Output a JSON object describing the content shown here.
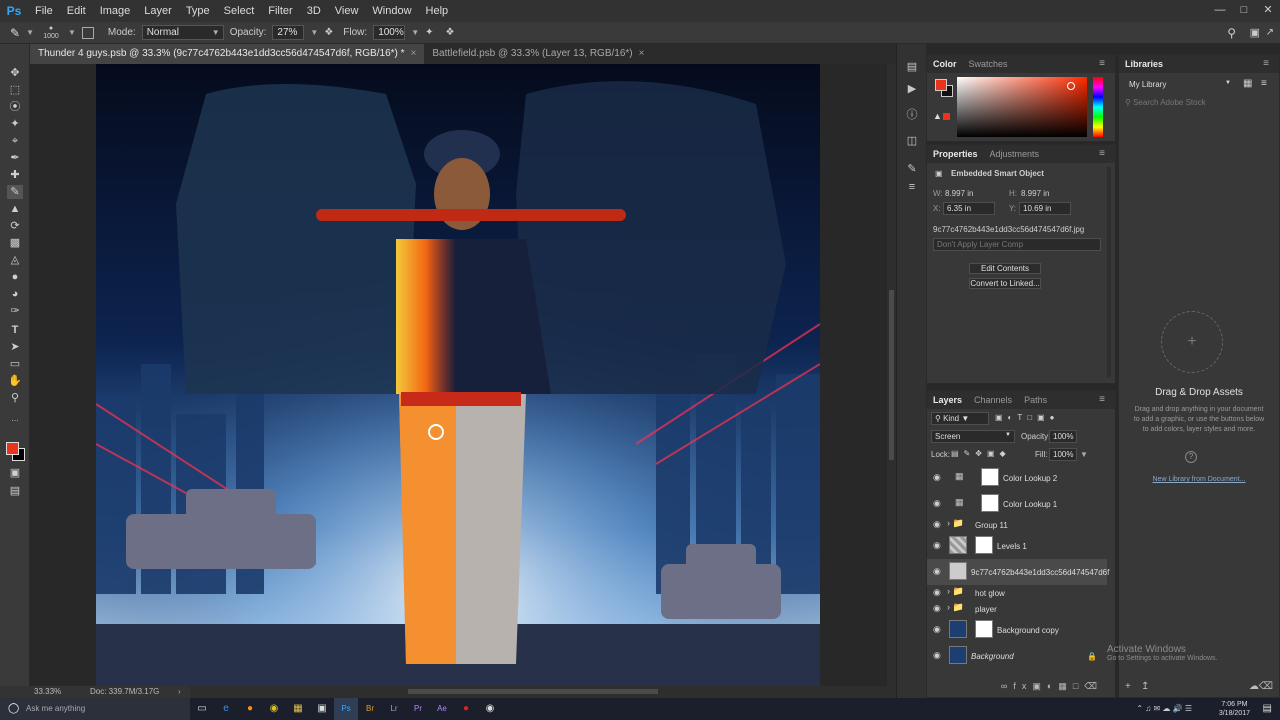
{
  "app": {
    "logo": "Ps"
  },
  "menu": [
    "File",
    "Edit",
    "Image",
    "Layer",
    "Type",
    "Select",
    "Filter",
    "3D",
    "View",
    "Window",
    "Help"
  ],
  "options": {
    "brush_size": "1000",
    "mode_label": "Mode:",
    "mode_value": "Normal",
    "opacity_label": "Opacity:",
    "opacity_value": "27%",
    "flow_label": "Flow:",
    "flow_value": "100%"
  },
  "tabs": [
    {
      "label": "Thunder 4 guys.psb @ 33.3% (9c77c4762b443e1dd3cc56d474547d6f, RGB/16*) *",
      "active": true
    },
    {
      "label": "Battlefield.psb @ 33.3% (Layer 13, RGB/16*)",
      "active": false
    }
  ],
  "status": {
    "zoom": "33.33%",
    "doc": "Doc: 339.7M/3.17G"
  },
  "color_panel": {
    "tabs": [
      "Color",
      "Swatches"
    ],
    "fg": "#e8341c",
    "bg": "#111111"
  },
  "properties": {
    "tabs": [
      "Properties",
      "Adjustments"
    ],
    "title": "Embedded Smart Object",
    "w_label": "W:",
    "w": "8.997 in",
    "h_label": "H:",
    "h": "8.997 in",
    "x_label": "X:",
    "x": "6.35 in",
    "y_label": "Y:",
    "y": "10.69 in",
    "filename": "9c77c4762b443e1dd3cc56d474547d6f.jpg",
    "layer_comp": "Don't Apply Layer Comp",
    "edit_btn": "Edit Contents",
    "convert_btn": "Convert to Linked..."
  },
  "layers_panel": {
    "tabs": [
      "Layers",
      "Channels",
      "Paths"
    ],
    "kind": "Kind",
    "blend": "Screen",
    "opacity_label": "Opacity:",
    "opacity": "100%",
    "lock_label": "Lock:",
    "fill_label": "Fill:",
    "fill": "100%",
    "layers": [
      {
        "name": "Color Lookup 2",
        "type": "adjustment"
      },
      {
        "name": "Color Lookup 1",
        "type": "adjustment"
      },
      {
        "name": "Group 11",
        "type": "group"
      },
      {
        "name": "Levels 1",
        "type": "levels"
      },
      {
        "name": "9c77c4762b443e1dd3cc56d474547d6f",
        "type": "smart",
        "selected": true
      },
      {
        "name": "hot glow",
        "type": "group"
      },
      {
        "name": "player",
        "type": "group"
      },
      {
        "name": "Background copy",
        "type": "image"
      },
      {
        "name": "Background",
        "type": "image",
        "locked": true
      }
    ]
  },
  "libraries": {
    "tab": "Libraries",
    "library": "My Library",
    "search_placeholder": "Search Adobe Stock",
    "drag_title": "Drag & Drop Assets",
    "drag_desc": "Drag and drop anything in your document to add a graphic, or use the buttons below to add colors, layer styles and more.",
    "new_link": "New Library from Document..."
  },
  "watermark": {
    "title": "Activate Windows",
    "sub": "Go to Settings to activate Windows."
  },
  "taskbar": {
    "search": "Ask me anything",
    "time": "7:06 PM",
    "date": "3/18/2017"
  }
}
